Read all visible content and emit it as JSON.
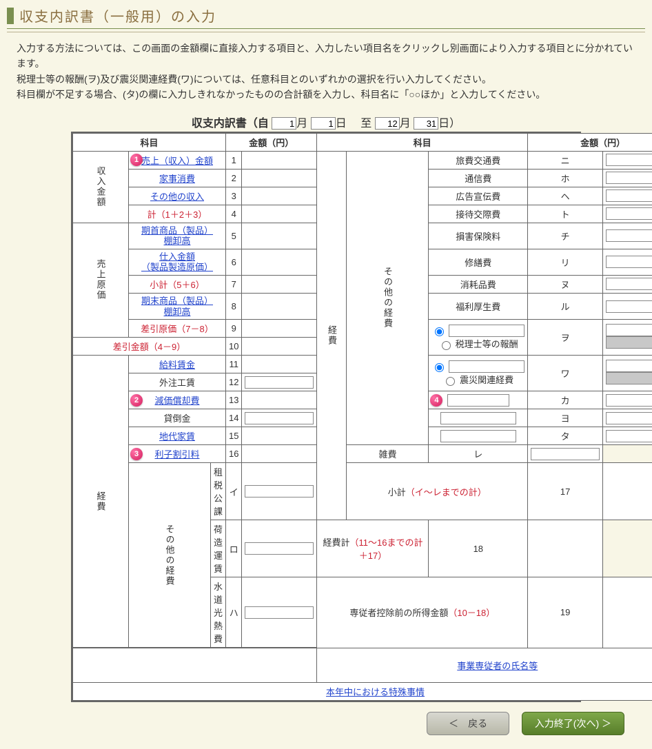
{
  "page_title": "収支内訳書（一般用）の入力",
  "intro_lines": [
    "入力する方法については、この画面の金額欄に直接入力する項目と、入力したい項目名をクリックし別画面により入力する項目とに分かれています。",
    "税理士等の報酬(ヲ)及び震災関連経費(ワ)については、任意科目とのいずれかの選択を行い入力してください。",
    "科目欄が不足する場合、(タ)の欄に入力しきれなかったものの合計額を入力し、科目名に「○○ほか」と入力してください。"
  ],
  "date_line": {
    "prefix": "収支内訳書（自",
    "m1": "1",
    "d1": "1",
    "mid": "至",
    "m2": "12",
    "d2": "31",
    "suffix": "日）",
    "month_label": "月",
    "day_label": "日"
  },
  "hdr": {
    "item": "科目",
    "amount": "金額（円）"
  },
  "left": {
    "sec1": "収入金額",
    "sec2": "売上原価",
    "sec3": "経費",
    "sec3b": "その他の経費",
    "rows": [
      {
        "badge": "1",
        "item": "売上（収入）金額",
        "link": true,
        "num": "1"
      },
      {
        "item": "家事消費",
        "link": true,
        "num": "2"
      },
      {
        "item": "その他の収入",
        "link": true,
        "num": "3"
      },
      {
        "item_red": "計（1＋2＋3）",
        "num": "4"
      },
      {
        "item": "期首商品（製品）棚卸高",
        "link": true,
        "num": "5",
        "twoLine": true
      },
      {
        "item": "仕入金額（製品製造原価）",
        "link": true,
        "num": "6",
        "twoLine": true
      },
      {
        "item_red": "小計（5＋6）",
        "num": "7"
      },
      {
        "item": "期末商品（製品）棚卸高",
        "link": true,
        "num": "8",
        "twoLine": true
      },
      {
        "item_red": "差引原価（7－8）",
        "num": "9"
      },
      {
        "item_red": "差引金額（4－9）",
        "num": "10",
        "wide": true
      },
      {
        "item": "給料賃金",
        "link": true,
        "num": "11"
      },
      {
        "item": "外注工賃",
        "num": "12",
        "input": true
      },
      {
        "badge": "2",
        "item": "減価償却費",
        "link": true,
        "num": "13"
      },
      {
        "item": "貸倒金",
        "num": "14",
        "input": true
      },
      {
        "item": "地代家賃",
        "link": true,
        "num": "15"
      },
      {
        "badge": "3",
        "item": "利子割引料",
        "link": true,
        "num": "16"
      },
      {
        "item": "租税公課",
        "kana": "イ",
        "num": "",
        "input": true
      },
      {
        "item": "荷造運賃",
        "kana": "ロ",
        "num": "",
        "input": true
      },
      {
        "item": "水道光熱費",
        "kana": "ハ",
        "num": "",
        "input": true
      }
    ]
  },
  "right": {
    "sec": "経費",
    "sec_sub": "その他の経費",
    "rows": [
      {
        "item": "旅費交通費",
        "kana": "ニ",
        "input": true
      },
      {
        "item": "通信費",
        "kana": "ホ",
        "input": true
      },
      {
        "item": "広告宣伝費",
        "kana": "ヘ",
        "input": true
      },
      {
        "item": "接待交際費",
        "kana": "ト",
        "input": true
      },
      {
        "item": "損害保険料",
        "kana": "チ",
        "input": true
      },
      {
        "item": "修繕費",
        "kana": "リ",
        "input": true
      },
      {
        "item": "消耗品費",
        "kana": "ヌ",
        "input": true
      },
      {
        "item": "福利厚生費",
        "kana": "ル",
        "input": true
      }
    ],
    "opt1_label": "税理士等の報酬",
    "opt2_label": "震災関連経費",
    "opt_kana1": "ヲ",
    "opt_kana2": "ワ",
    "custom_kana1": "カ",
    "custom_kana2": "ヨ",
    "custom_kana3": "タ",
    "zappi": "雑費",
    "zappi_kana": "レ",
    "subtotal": "小計",
    "subtotal_note": "（イ～レまでの計）",
    "subtotal_num": "17",
    "keihi_total": "経費計",
    "keihi_note": "（11～16までの計＋17）",
    "keihi_num": "18",
    "pre_deduction": "専従者控除前の所得金額",
    "pre_note": "（10－18）",
    "pre_num": "19",
    "senju_link": "事業専従者の氏名等",
    "badge4": "4"
  },
  "bottom_link": "本年中における特殊事情",
  "btn_back": "＜　戻る",
  "btn_next": "入力終了(次へ) ＞"
}
